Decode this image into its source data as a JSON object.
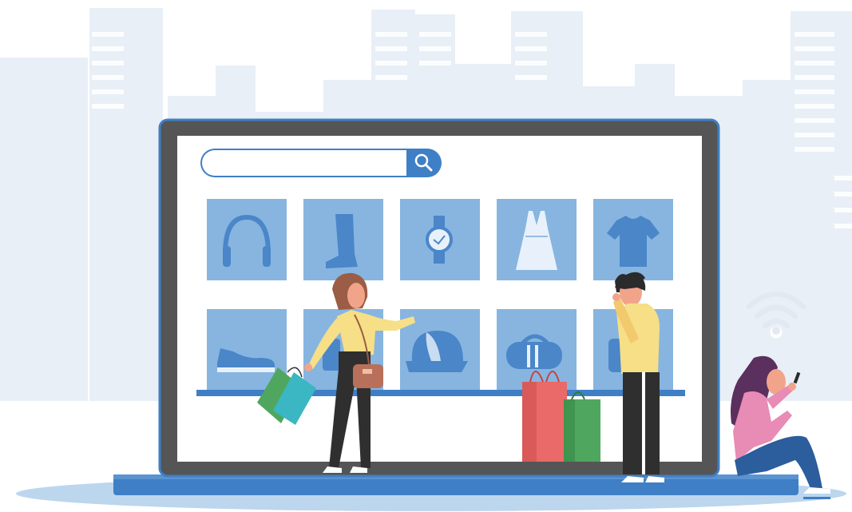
{
  "colors": {
    "city_skyline": "#e8eff7",
    "laptop_frame": "#555555",
    "laptop_bezel_accent": "#3f7fc6",
    "product_tile": "#87b5e0",
    "product_icon": "#4a86c8",
    "shelf": "#3f7fc6",
    "ground_shadow": "#bcd6ee",
    "shopping_bag_red": "#e96a68",
    "shopping_bag_green": "#4fa75f",
    "shopping_bag_teal": "#3ab7c2",
    "shirt_yellow": "#f6df86",
    "pants_dark": "#2f2f2f",
    "hair_brown": "#9b5d45",
    "top_pink": "#e88bb5",
    "jeans_blue": "#2c5d9c"
  },
  "search": {
    "placeholder": "",
    "value": ""
  },
  "products": [
    {
      "icon": "headphones-icon"
    },
    {
      "icon": "boot-icon"
    },
    {
      "icon": "wristwatch-icon"
    },
    {
      "icon": "dress-icon"
    },
    {
      "icon": "tshirt-icon"
    },
    {
      "icon": "sneaker-icon"
    },
    {
      "icon": "handbag-icon"
    },
    {
      "icon": "cap-icon"
    },
    {
      "icon": "duffel-bag-icon"
    },
    {
      "icon": "backpack-icon"
    }
  ],
  "people": [
    {
      "icon": "woman-shopper-pointing"
    },
    {
      "icon": "man-thinking"
    },
    {
      "icon": "woman-sitting-with-phone"
    }
  ],
  "decor": [
    {
      "icon": "wifi-icon"
    },
    {
      "icon": "city-skyline"
    },
    {
      "icon": "shopping-bags-icon"
    }
  ]
}
